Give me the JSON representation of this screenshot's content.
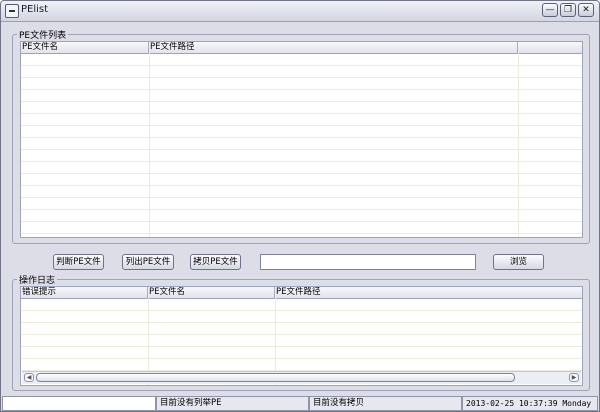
{
  "window": {
    "title": "PElist"
  },
  "file_list": {
    "group_label": "PE文件列表",
    "columns": [
      "PE文件名",
      "PE文件路径"
    ]
  },
  "toolbar": {
    "judge_label": "判断PE文件",
    "list_label": "列出PE文件",
    "copy_label": "拷贝PE文件",
    "path_value": "",
    "browse_label": "浏览"
  },
  "log": {
    "group_label": "操作日志",
    "columns": [
      "错误提示",
      "PE文件名",
      "PE文件路径"
    ]
  },
  "status": {
    "pane1": "",
    "pane2": "目前没有列举PE",
    "pane3": "目前没有拷贝",
    "datetime": "2013-02-25 10:37:39 Monday"
  }
}
